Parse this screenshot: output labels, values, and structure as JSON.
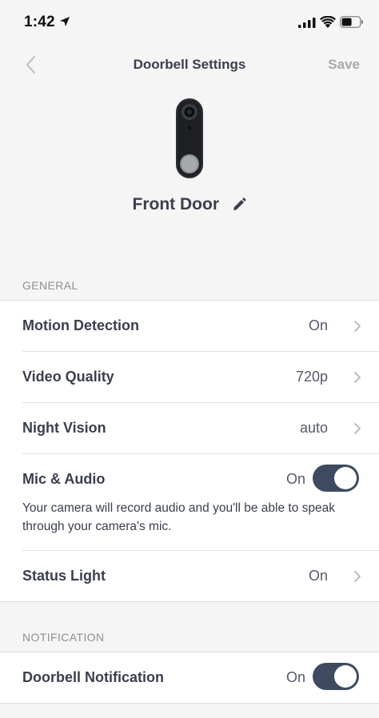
{
  "status_bar": {
    "time": "1:42"
  },
  "nav": {
    "title": "Doorbell Settings",
    "save_label": "Save"
  },
  "device": {
    "name": "Front Door"
  },
  "sections": {
    "general": {
      "header": "GENERAL",
      "motion_detection": {
        "label": "Motion Detection",
        "value": "On"
      },
      "video_quality": {
        "label": "Video Quality",
        "value": "720p"
      },
      "night_vision": {
        "label": "Night Vision",
        "value": "auto"
      },
      "mic_audio": {
        "label": "Mic & Audio",
        "value": "On",
        "enabled": true,
        "description": "Your camera will record audio and you'll be able to speak through your camera's mic."
      },
      "status_light": {
        "label": "Status Light",
        "value": "On"
      }
    },
    "notification": {
      "header": "NOTIFICATION",
      "doorbell_notification": {
        "label": "Doorbell Notification",
        "value": "On",
        "enabled": true
      }
    }
  },
  "colors": {
    "toggle_on": "#3e4a5f",
    "background": "#f5f5f5",
    "text_primary": "#3a3f4d",
    "text_muted": "#8d8e93"
  }
}
